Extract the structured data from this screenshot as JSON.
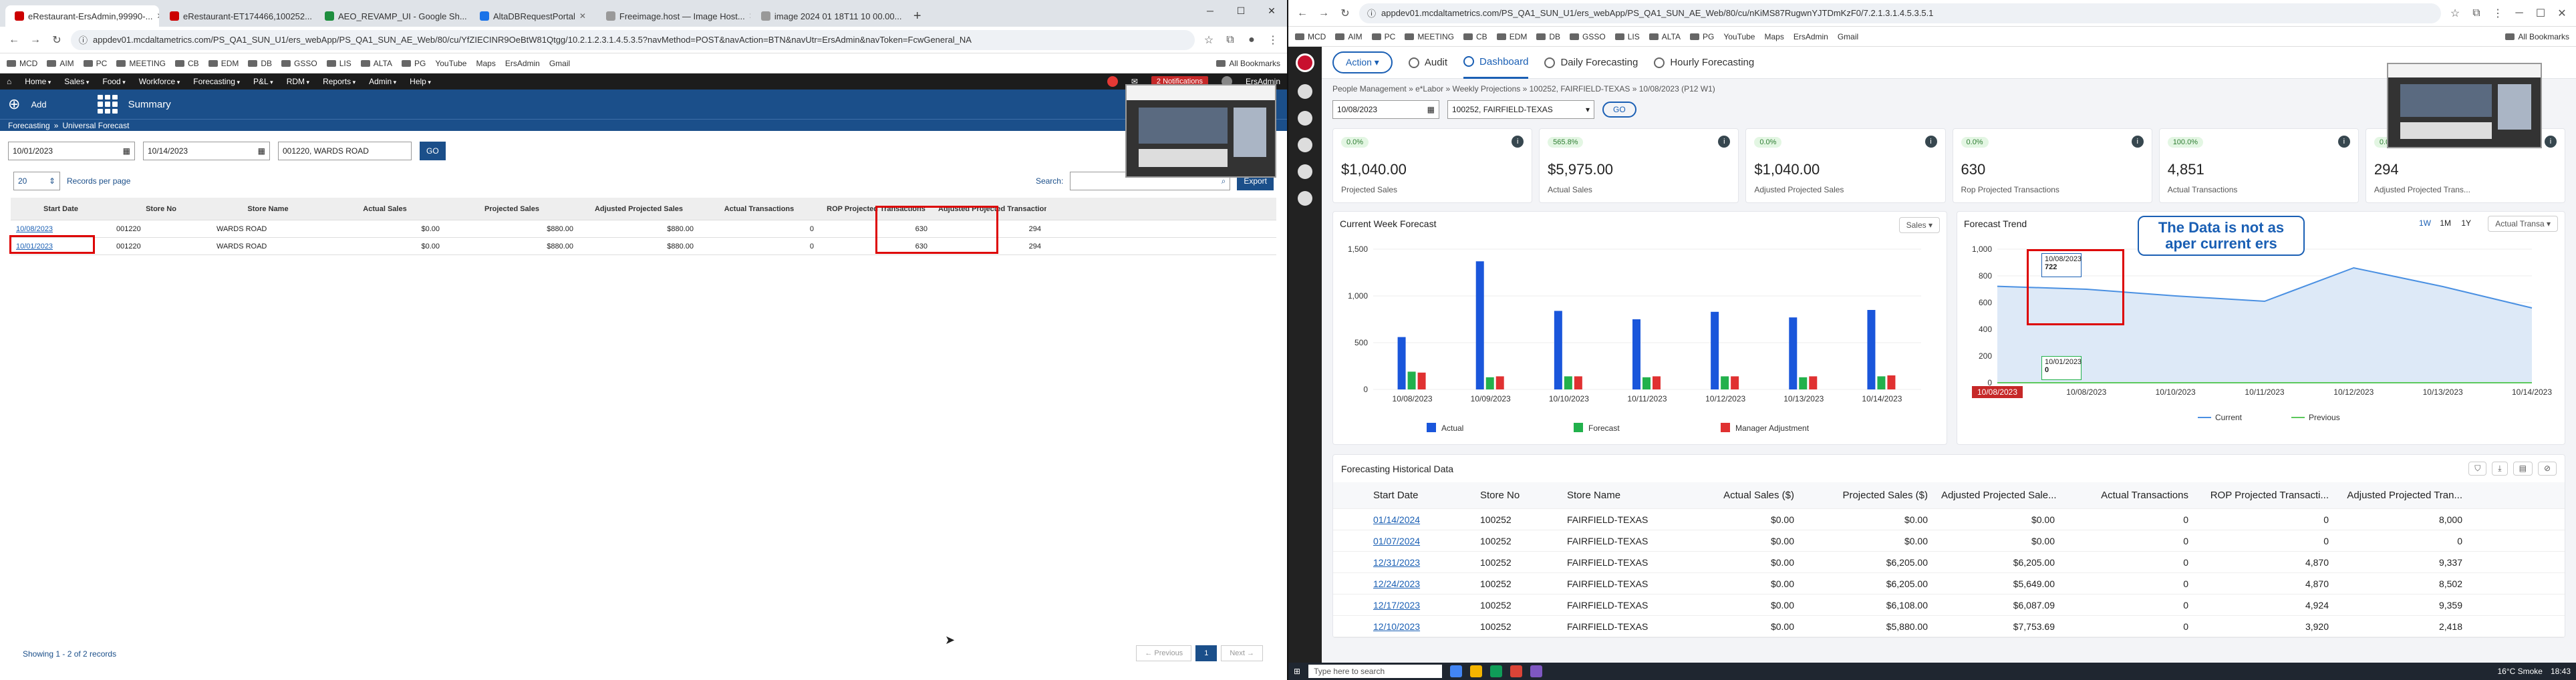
{
  "left": {
    "tabs": [
      "eRestaurant-ErsAdmin,99990-...",
      "eRestaurant-ET174466,100252...",
      "AEO_REVAMP_UI - Google Sh...",
      "AltaDBRequestPortal",
      "Freeimage.host — Image Host...",
      "image 2024 01 18T11 10 00.00..."
    ],
    "url": "appdev01.mcdaltametrics.com/PS_QA1_SUN_U1/ers_webApp/PS_QA1_SUN_AE_Web/80/cu/YfZIECINR9OeBtW81Qtgg/10.2.1.2.3.1.4.5.3.5?navMethod=POST&navAction=BTN&navUtr=ErsAdmin&navToken=FcwGeneral_NA",
    "bookmarks": [
      "MCD",
      "AIM",
      "PC",
      "MEETING",
      "CB",
      "EDM",
      "DB",
      "GSSO",
      "LIS",
      "ALTA",
      "PG",
      "YouTube",
      "Maps",
      "ErsAdmin",
      "Gmail"
    ],
    "all_bookmarks": "All Bookmarks",
    "menu": [
      "Home",
      "Sales",
      "Food",
      "Workforce",
      "Forecasting",
      "P&L",
      "RDM",
      "Reports",
      "Admin",
      "Help"
    ],
    "notifications": "2 Notifications",
    "user": "ErsAdmin",
    "banner": {
      "add": "Add",
      "summary": "Summary"
    },
    "breadcrumb": [
      "Forecasting",
      "Universal Forecast"
    ],
    "filters": {
      "start": "10/01/2023",
      "end": "10/14/2023",
      "store": "001220, WARDS ROAD",
      "go": "GO"
    },
    "records": {
      "value": "20",
      "label": "Records per page"
    },
    "search_label": "Search:",
    "export": "Export",
    "columns": [
      "Start Date",
      "Store No",
      "Store Name",
      "Actual Sales",
      "Projected Sales",
      "Adjusted Projected Sales",
      "Actual Transactions",
      "ROP Projected Transactions",
      "Adjusted Projected Transactions"
    ],
    "rows": [
      [
        "10/08/2023",
        "001220",
        "WARDS ROAD",
        "$0.00",
        "$880.00",
        "$880.00",
        "0",
        "630",
        "294"
      ],
      [
        "10/01/2023",
        "001220",
        "WARDS ROAD",
        "$0.00",
        "$880.00",
        "$880.00",
        "0",
        "630",
        "294"
      ]
    ],
    "showing": "Showing 1 - 2 of 2 records",
    "pager": {
      "prev": "← Previous",
      "page": "1",
      "next": "Next →"
    }
  },
  "right": {
    "url": "appdev01.mcdaltametrics.com/PS_QA1_SUN_U1/ers_webApp/PS_QA1_SUN_AE_Web/80/cu/nKiMS87RugwnYJTDmKzF0/7.2.1.3.1.4.5.3.5.1",
    "bookmarks": [
      "MCD",
      "AIM",
      "PC",
      "MEETING",
      "CB",
      "EDM",
      "DB",
      "GSSO",
      "LIS",
      "ALTA",
      "PG",
      "YouTube",
      "Maps",
      "ErsAdmin",
      "Gmail"
    ],
    "all_bookmarks": "All Bookmarks",
    "action": "Action",
    "tabs": [
      "Audit",
      "Dashboard",
      "Daily Forecasting",
      "Hourly Forecasting"
    ],
    "breadcrumb": "People Management » e*Labor » Weekly Projections » 100252, FAIRFIELD-TEXAS » 10/08/2023 (P12 W1)",
    "date": "10/08/2023",
    "store": "100252, FAIRFIELD-TEXAS",
    "go": "GO",
    "kpis": [
      {
        "chip": "0.0%",
        "value": "$1,040.00",
        "label": "Projected Sales"
      },
      {
        "chip": "565.8%",
        "value": "$5,975.00",
        "label": "Actual Sales"
      },
      {
        "chip": "0.0%",
        "value": "$1,040.00",
        "label": "Adjusted Projected Sales"
      },
      {
        "chip": "0.0%",
        "value": "630",
        "label": "Rop Projected Transactions"
      },
      {
        "chip": "100.0%",
        "value": "4,851",
        "label": "Actual Transactions"
      },
      {
        "chip": "0.0%",
        "value": "294",
        "label": "Adjusted Projected Trans..."
      }
    ],
    "week_title": "Current Week Forecast",
    "week_select": "Sales",
    "trend_title": "Forecast Trend",
    "trend_ranges": [
      "1W",
      "1M",
      "1Y"
    ],
    "trend_select": "Actual Transa",
    "callout": "The Data is not as aper current ers",
    "tip1": {
      "date": "10/08/2023",
      "value": "722"
    },
    "tip2": {
      "date": "10/01/2023",
      "value": "0"
    },
    "hist_title": "Forecasting Historical Data",
    "hist_columns": [
      "Start Date",
      "Store No",
      "Store Name",
      "Actual Sales ($)",
      "Projected Sales ($)",
      "Adjusted Projected Sale...",
      "Actual Transactions",
      "ROP Projected Transacti...",
      "Adjusted Projected Tran..."
    ],
    "hist_rows": [
      [
        "01/14/2024",
        "100252",
        "FAIRFIELD-TEXAS",
        "$0.00",
        "$0.00",
        "$0.00",
        "0",
        "0",
        "8,000"
      ],
      [
        "01/07/2024",
        "100252",
        "FAIRFIELD-TEXAS",
        "$0.00",
        "$0.00",
        "$0.00",
        "0",
        "0",
        "0"
      ],
      [
        "12/31/2023",
        "100252",
        "FAIRFIELD-TEXAS",
        "$0.00",
        "$6,205.00",
        "$6,205.00",
        "0",
        "4,870",
        "9,337"
      ],
      [
        "12/24/2023",
        "100252",
        "FAIRFIELD-TEXAS",
        "$0.00",
        "$6,205.00",
        "$5,649.00",
        "0",
        "4,870",
        "8,502"
      ],
      [
        "12/17/2023",
        "100252",
        "FAIRFIELD-TEXAS",
        "$0.00",
        "$6,108.00",
        "$6,087.09",
        "0",
        "4,924",
        "9,359"
      ],
      [
        "12/10/2023",
        "100252",
        "FAIRFIELD-TEXAS",
        "$0.00",
        "$5,880.00",
        "$7,753.69",
        "0",
        "3,920",
        "2,418"
      ]
    ],
    "taskbar": {
      "search": "Type here to search",
      "weather": "16°C  Smoke",
      "time": "18:43"
    }
  },
  "chart_data": [
    {
      "type": "bar",
      "title": "Current Week Forecast",
      "categories": [
        "10/08/2023",
        "10/09/2023",
        "10/10/2023",
        "10/11/2023",
        "10/12/2023",
        "10/13/2023",
        "10/14/2023"
      ],
      "ylim": [
        0,
        1500
      ],
      "yticks": [
        0,
        500,
        1000,
        1500
      ],
      "series": [
        {
          "name": "Actual",
          "color": "#1a56db",
          "values": [
            560,
            1370,
            840,
            750,
            830,
            770,
            850
          ]
        },
        {
          "name": "Forecast",
          "color": "#22b14c",
          "values": [
            190,
            130,
            140,
            130,
            140,
            130,
            140
          ]
        },
        {
          "name": "Manager Adjustment",
          "color": "#e03131",
          "values": [
            180,
            140,
            140,
            140,
            140,
            140,
            150
          ]
        }
      ]
    },
    {
      "type": "area",
      "title": "Forecast Trend",
      "categories": [
        "10/08/2023",
        "10/08/2023",
        "10/10/2023",
        "10/11/2023",
        "10/12/2023",
        "10/13/2023",
        "10/14/2023"
      ],
      "ylim": [
        0,
        1000
      ],
      "yticks": [
        0,
        200,
        400,
        600,
        800,
        1000
      ],
      "series": [
        {
          "name": "Current",
          "color": "#4a90e2",
          "values": [
            722,
            700,
            650,
            610,
            860,
            720,
            560
          ]
        },
        {
          "name": "Previous",
          "color": "#5cc85c",
          "values": [
            0,
            0,
            0,
            0,
            0,
            0,
            0
          ]
        }
      ]
    }
  ]
}
